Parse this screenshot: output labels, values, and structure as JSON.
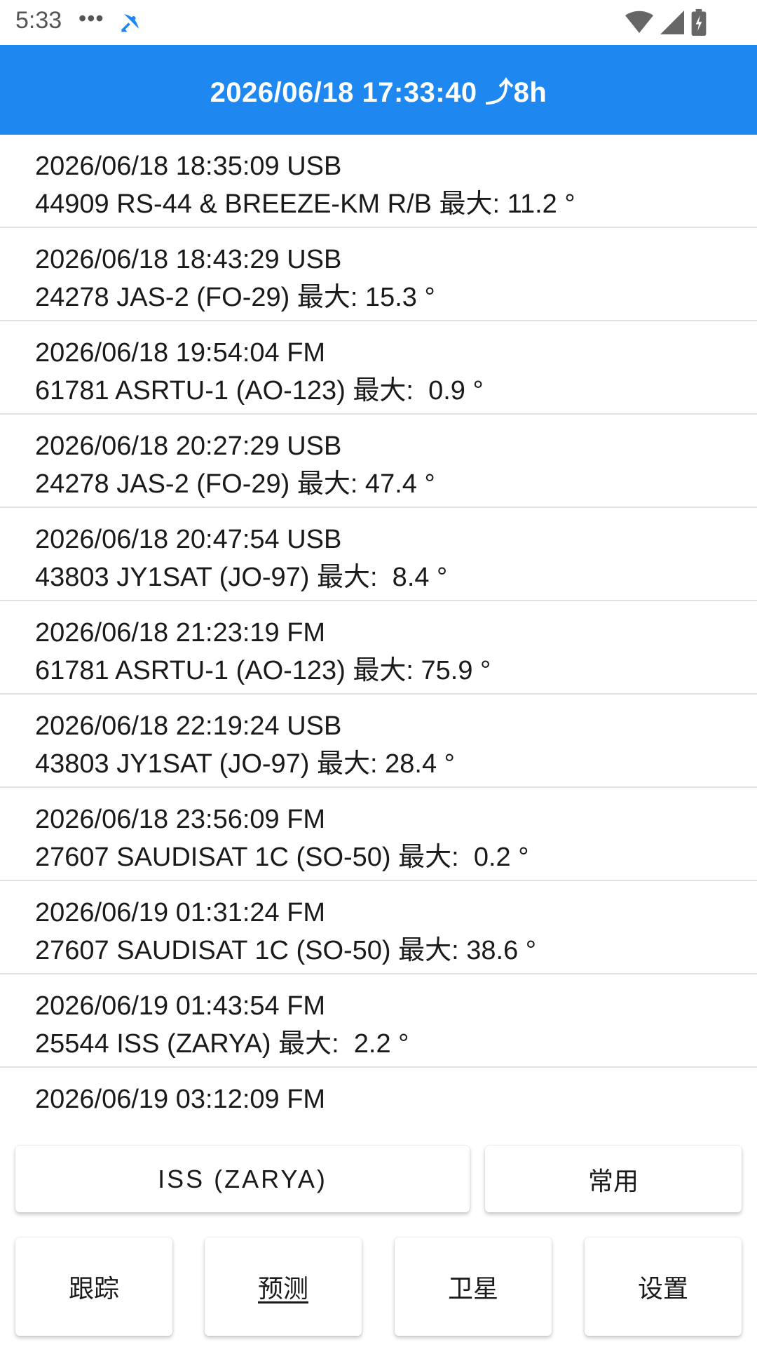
{
  "status_bar": {
    "time": "5:33",
    "dots": "•••"
  },
  "header": {
    "title": "2026/06/18 17:33:40 ⤴8h"
  },
  "passes": [
    {
      "line1": "2026/06/18 18:35:09 USB",
      "line2": "44909 RS-44 & BREEZE-KM R/B 最大: 11.2 °"
    },
    {
      "line1": "2026/06/18 18:43:29 USB",
      "line2": "24278 JAS-2 (FO-29) 最大: 15.3 °"
    },
    {
      "line1": "2026/06/18 19:54:04 FM",
      "line2": "61781 ASRTU-1 (AO-123) 最大:  0.9 °"
    },
    {
      "line1": "2026/06/18 20:27:29 USB",
      "line2": "24278 JAS-2 (FO-29) 最大: 47.4 °"
    },
    {
      "line1": "2026/06/18 20:47:54 USB",
      "line2": "43803 JY1SAT (JO-97) 最大:  8.4 °"
    },
    {
      "line1": "2026/06/18 21:23:19 FM",
      "line2": "61781 ASRTU-1 (AO-123) 最大: 75.9 °"
    },
    {
      "line1": "2026/06/18 22:19:24 USB",
      "line2": "43803 JY1SAT (JO-97) 最大: 28.4 °"
    },
    {
      "line1": "2026/06/18 23:56:09 FM",
      "line2": "27607 SAUDISAT 1C (SO-50) 最大:  0.2 °"
    },
    {
      "line1": "2026/06/19 01:31:24 FM",
      "line2": "27607 SAUDISAT 1C (SO-50) 最大: 38.6 °"
    },
    {
      "line1": "2026/06/19 01:43:54 FM",
      "line2": "25544 ISS (ZARYA) 最大:  2.2 °"
    },
    {
      "line1": "2026/06/19 03:12:09 FM",
      "line2": ""
    }
  ],
  "controls": {
    "satellite_button": "ISS (ZARYA)",
    "common_button": "常用"
  },
  "nav": {
    "track": "跟踪",
    "predict": "预测",
    "satellite": "卫星",
    "settings": "设置"
  },
  "colors": {
    "header_bg": "#1e88f0",
    "divider": "#e2e2e2"
  }
}
